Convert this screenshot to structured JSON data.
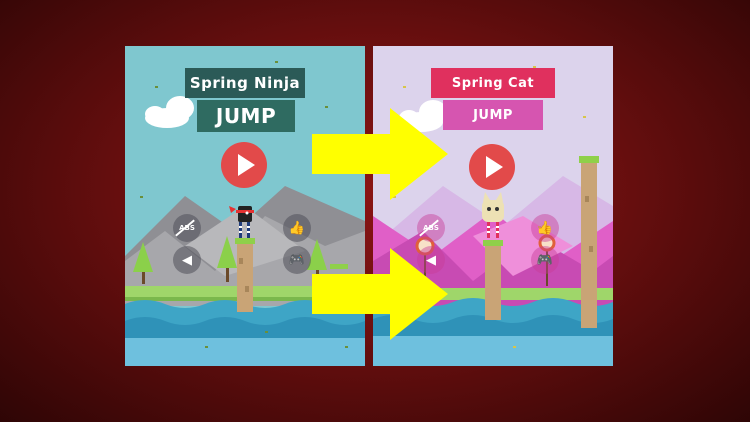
{
  "left_game": {
    "title_line1": "Spring Ninja",
    "title_line2": "JUMP",
    "colors": {
      "sky": "#7fc7cf",
      "water": "#3ea5c6",
      "grass": "#9fd66a",
      "mountain": "#8f8f94",
      "title_dark": "#2b5a57",
      "play": "#e24a4a"
    },
    "buttons": {
      "no_ads": "ABS",
      "like": "thumbs-up-icon",
      "sound": "speaker-icon",
      "games": "gamepad-icon",
      "play": "play-icon"
    }
  },
  "right_game": {
    "title_line1": "Spring Cat",
    "title_line2": "JUMP",
    "colors": {
      "sky": "#dcd3ec",
      "water": "#3ea5c6",
      "grass": "#9fd66a",
      "mountain": "#e05fc7",
      "title_pink": "#e0305e",
      "play": "#e24a4a"
    },
    "buttons": {
      "no_ads": "ABS",
      "like": "thumbs-up-icon",
      "sound": "speaker-icon",
      "games": "gamepad-icon",
      "play": "play-icon"
    }
  },
  "arrows_color": "#ffff00"
}
